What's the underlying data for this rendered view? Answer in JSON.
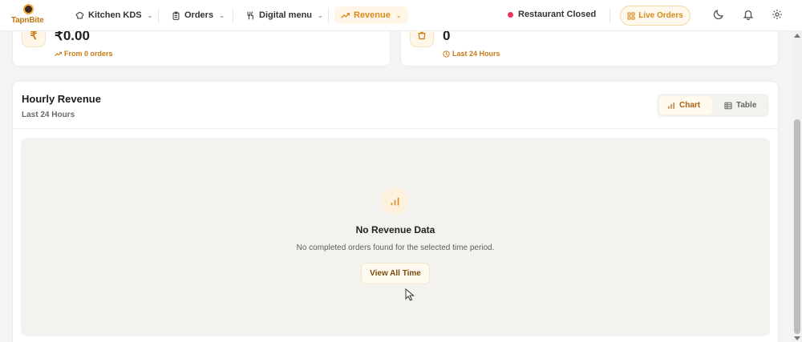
{
  "app": {
    "name": "TapnBite"
  },
  "nav": {
    "items": [
      {
        "label": "Kitchen KDS",
        "icon": "chef-hat-icon"
      },
      {
        "label": "Orders",
        "icon": "clipboard-icon"
      },
      {
        "label": "Digital menu",
        "icon": "utensils-icon"
      },
      {
        "label": "Revenue",
        "icon": "trending-up-icon",
        "active": true
      }
    ],
    "status": "Restaurant Closed",
    "live_orders": "Live Orders"
  },
  "stats": {
    "revenue": {
      "value": "₹0.00",
      "sub": "From 0 orders",
      "icon": "rupee-icon"
    },
    "orders": {
      "value": "0",
      "sub": "Last 24 Hours",
      "icon": "shopping-bag-icon"
    }
  },
  "hourly": {
    "title": "Hourly Revenue",
    "subtitle": "Last 24 Hours",
    "toggle": {
      "chart": "Chart",
      "table": "Table",
      "selected": "Chart"
    },
    "empty": {
      "title": "No Revenue Data",
      "description": "No completed orders found for the selected time period.",
      "button": "View All Time"
    }
  },
  "colors": {
    "accent": "#d58a1e",
    "status_closed": "#e8335c"
  }
}
